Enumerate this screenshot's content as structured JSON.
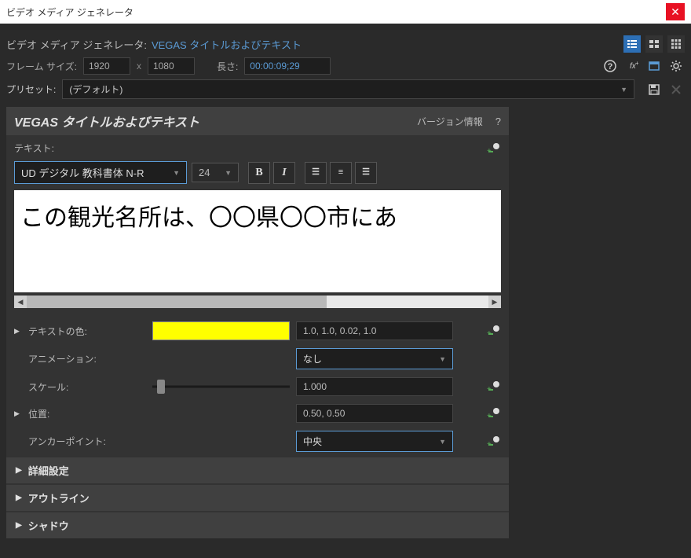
{
  "window": {
    "title": "ビデオ メディア ジェネレータ"
  },
  "header": {
    "title": "ビデオ メディア ジェネレータ:",
    "subtitle": "VEGAS タイトルおよびテキスト"
  },
  "frame": {
    "size_label": "フレーム サイズ:",
    "width": "1920",
    "x": "x",
    "height": "1080",
    "length_label": "長さ:",
    "length": "00:00:09;29"
  },
  "preset": {
    "label": "プリセット:",
    "value": "(デフォルト)"
  },
  "panel": {
    "title": "VEGAS タイトルおよびテキスト",
    "version": "バージョン情報",
    "help": "?"
  },
  "text": {
    "label": "テキスト:",
    "font": "UD デジタル 教科書体 N-R",
    "size": "24",
    "content": "この観光名所は、〇〇県〇〇市にあ"
  },
  "props": {
    "color_label": "テキストの色:",
    "color_hex": "#ffff00",
    "color_text": "1.0, 1.0, 0.02, 1.0",
    "anim_label": "アニメーション:",
    "anim_value": "なし",
    "scale_label": "スケール:",
    "scale_value": "1.000",
    "pos_label": "位置:",
    "pos_value": "0.50, 0.50",
    "anchor_label": "アンカーポイント:",
    "anchor_value": "中央"
  },
  "sections": {
    "advanced": "詳細設定",
    "outline": "アウトライン",
    "shadow": "シャドウ"
  }
}
